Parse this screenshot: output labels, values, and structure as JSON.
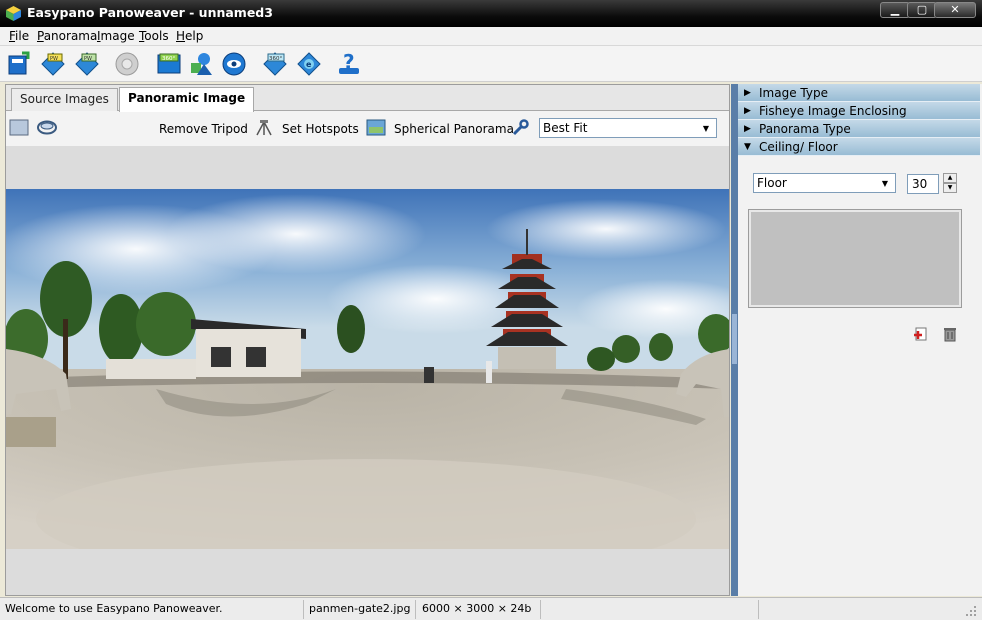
{
  "window": {
    "title": "Easypano Panoweaver - unnamed3"
  },
  "menu": {
    "items": [
      {
        "label_ul": "F",
        "label_rest": "ile"
      },
      {
        "label_ul": "P",
        "label_rest": "anorama"
      },
      {
        "label_ul": "I",
        "label_rest": "mage"
      },
      {
        "label_ul": "T",
        "label_rest": "ools"
      },
      {
        "label_ul": "H",
        "label_rest": "elp"
      }
    ]
  },
  "toolbar": {
    "icons": [
      "new-project-icon",
      "publish-flash-icon",
      "publish-java-icon",
      "stitch-icon",
      "publish-360-icon",
      "shapes-icon",
      "preview-eye-icon",
      "publish-360-web-icon",
      "publish-ie-icon",
      "help-icon"
    ]
  },
  "tabs": {
    "source": "Source Images",
    "panoramic": "Panoramic Image",
    "active": "panoramic"
  },
  "subbar": {
    "remove_tripod": "Remove Tripod",
    "set_hotspots": "Set Hotspots",
    "spherical_panorama": "Spherical Panorama",
    "zoom_value": "Best Fit"
  },
  "sections": {
    "image_type": "Image Type",
    "fisheye": "Fisheye Image Enclosing",
    "panorama_type": "Panorama Type",
    "ceiling_floor": "Ceiling/ Floor"
  },
  "ceiling_floor": {
    "selection": "Floor",
    "size": "30"
  },
  "status": {
    "message": "Welcome to use Easypano Panoweaver.",
    "filename": "panmen-gate2.jpg",
    "dimensions": "6000 × 3000 × 24b"
  },
  "colors": {
    "titlebar": "#000000",
    "splitter": "#5a7ea8",
    "section_header": "#a8c6dc"
  }
}
